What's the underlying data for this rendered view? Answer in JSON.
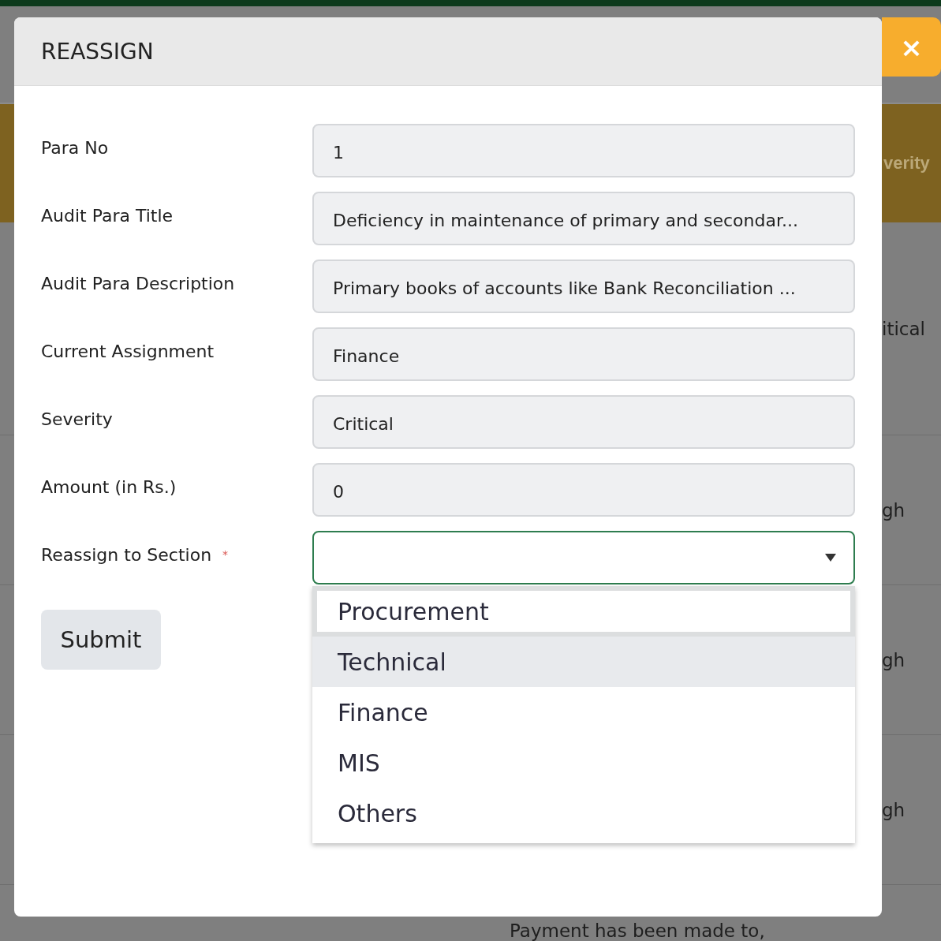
{
  "background": {
    "column_fragments": [
      "verity",
      "itical",
      "gh",
      "gh",
      "gh"
    ],
    "bottom_row_text": "Payment has been made to,"
  },
  "dialog": {
    "title": "REASSIGN",
    "close": "×",
    "fields": [
      {
        "label": "Para No",
        "value": "1",
        "kind": "text"
      },
      {
        "label": "Audit Para Title",
        "value": "Deficiency in maintenance of primary and secondar...",
        "kind": "text"
      },
      {
        "label": "Audit Para Description",
        "value": "Primary books of accounts like Bank Reconciliation ...",
        "kind": "text"
      },
      {
        "label": "Current Assignment",
        "value": "Finance",
        "kind": "text"
      },
      {
        "label": "Severity",
        "value": "Critical",
        "kind": "text"
      },
      {
        "label": "Amount (in Rs.)",
        "value": "0",
        "kind": "text"
      },
      {
        "label": "Reassign to Section",
        "required_mark": "*",
        "kind": "select",
        "expanded": true,
        "options": [
          {
            "label": "Procurement",
            "focused": true,
            "hovered": false
          },
          {
            "label": "Technical",
            "focused": false,
            "hovered": true
          },
          {
            "label": "Finance",
            "focused": false,
            "hovered": false
          },
          {
            "label": "MIS",
            "focused": false,
            "hovered": false
          },
          {
            "label": "Others",
            "focused": false,
            "hovered": false
          }
        ]
      }
    ],
    "submit": "Submit"
  }
}
